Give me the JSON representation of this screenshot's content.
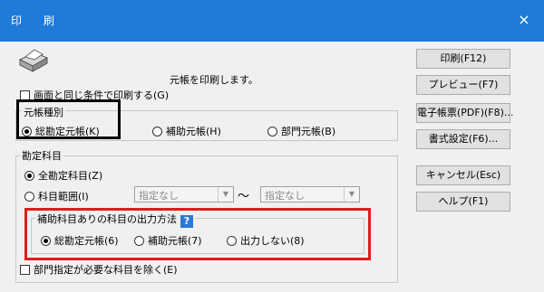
{
  "window": {
    "title": "印 刷",
    "close_glyph": "×"
  },
  "header": {
    "message": "元帳を印刷します。",
    "icon": "printer-icon"
  },
  "same_condition_checkbox": {
    "label": "画面と同じ条件で印刷する(G)",
    "checked": false
  },
  "ledger_type": {
    "legend": "元帳種別",
    "options": [
      {
        "label": "総勘定元帳(K)",
        "selected": true
      },
      {
        "label": "補助元帳(H)",
        "selected": false
      },
      {
        "label": "部門元帳(B)",
        "selected": false
      }
    ]
  },
  "account": {
    "legend": "勘定科目",
    "all_label": "全勘定科目(Z)",
    "range_label": "科目範囲(I)",
    "range_from": "指定なし",
    "range_to": "指定なし",
    "tilde": "～"
  },
  "sub_output": {
    "legend": "補助科目ありの科目の出力方法",
    "help_glyph": "?",
    "options": [
      {
        "label": "総勘定元帳(6)",
        "selected": true
      },
      {
        "label": "補助元帳(7)",
        "selected": false
      },
      {
        "label": "出力しない(8)",
        "selected": false
      }
    ]
  },
  "exclude_dept_checkbox": {
    "label": "部門指定が必要な科目を除く(E)",
    "checked": false
  },
  "buttons": {
    "print": "印刷(F12)",
    "preview": "プレビュー(F7)",
    "electronic": "電子帳票(PDF)(F8)...",
    "format": "書式設定(F6)...",
    "cancel": "キャンセル(Esc)",
    "help": "ヘルプ(F1)"
  },
  "colors": {
    "titlebar": "#1f7bd7",
    "highlight_black": "#000000",
    "highlight_red": "#e01b1b",
    "help_icon": "#2a79d4"
  }
}
